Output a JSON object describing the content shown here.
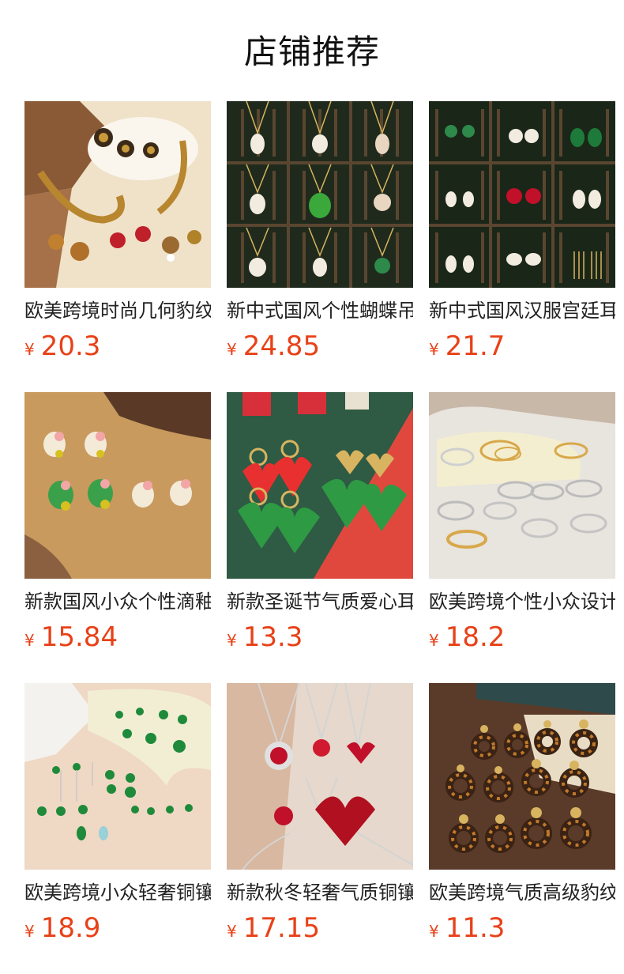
{
  "header": {
    "title": "店铺推荐"
  },
  "theme": {
    "price_color": "#e84118",
    "text_color": "#222222"
  },
  "products": [
    {
      "name": "欧美跨境时尚几何豹纹耳环",
      "currency": "¥",
      "price": "20.3",
      "image": "gold-leopard-jewelry-set-photo"
    },
    {
      "name": "新中式国风个性蝴蝶吊坠项链",
      "currency": "¥",
      "price": "24.85",
      "image": "chinese-style-pendant-necklaces-photo"
    },
    {
      "name": "新中式国风汉服宫廷耳环",
      "currency": "¥",
      "price": "21.7",
      "image": "chinese-court-earrings-photo"
    },
    {
      "name": "新款国风小众个性滴釉耳钉",
      "currency": "¥",
      "price": "15.84",
      "image": "jade-flower-stud-earrings-photo"
    },
    {
      "name": "新款圣诞节气质爱心耳环",
      "currency": "¥",
      "price": "13.3",
      "image": "christmas-heart-earrings-photo"
    },
    {
      "name": "欧美跨境个性小众设计手镯",
      "currency": "¥",
      "price": "18.2",
      "image": "metal-cuff-bracelets-photo"
    },
    {
      "name": "欧美跨境小众轻奢铜镶锆石耳环",
      "currency": "¥",
      "price": "18.9",
      "image": "emerald-stone-earrings-photo"
    },
    {
      "name": "新款秋冬轻奢气质铜镶锆石项链",
      "currency": "¥",
      "price": "17.15",
      "image": "ruby-pendant-necklaces-photo"
    },
    {
      "name": "欧美跨境气质高级豹纹耳环",
      "currency": "¥",
      "price": "11.3",
      "image": "tortoiseshell-hoop-earrings-photo"
    }
  ]
}
